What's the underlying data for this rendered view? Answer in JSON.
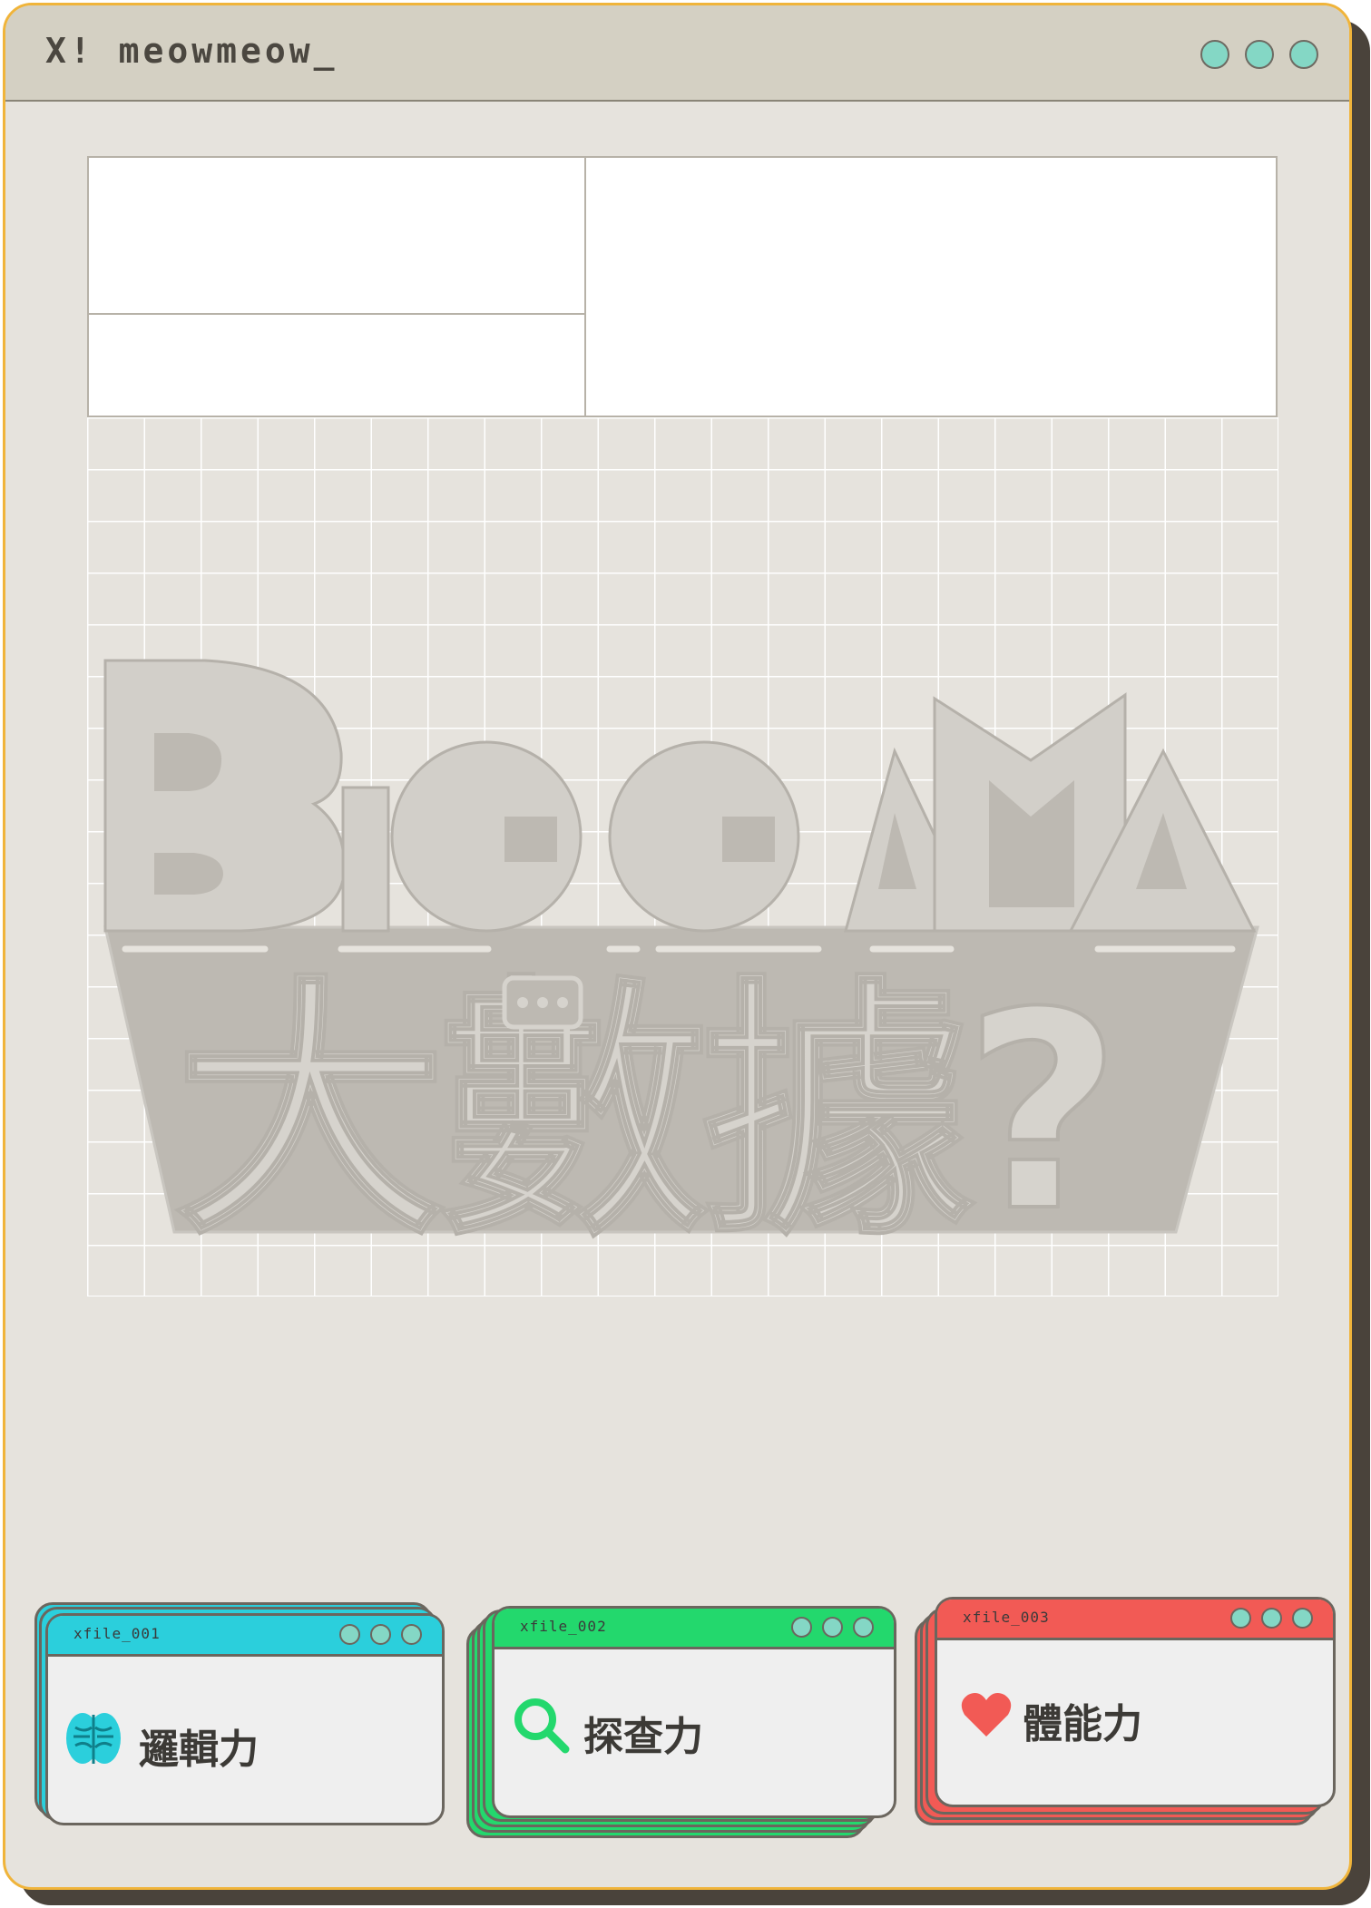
{
  "window": {
    "title": "X! meowmeow_",
    "border_color": "#f0b43a",
    "dot_color": "#84d7c5"
  },
  "logo": {
    "latin": "BIGGAMA",
    "chinese": "大數據?"
  },
  "cards": [
    {
      "file": "xfile_001",
      "label": "邏輯力",
      "icon": "brain-icon",
      "color": "#2bcfdc"
    },
    {
      "file": "xfile_002",
      "label": "探查力",
      "icon": "magnifier-icon",
      "color": "#23d86d"
    },
    {
      "file": "xfile_003",
      "label": "體能力",
      "icon": "heart-icon",
      "color": "#f25a55"
    }
  ]
}
